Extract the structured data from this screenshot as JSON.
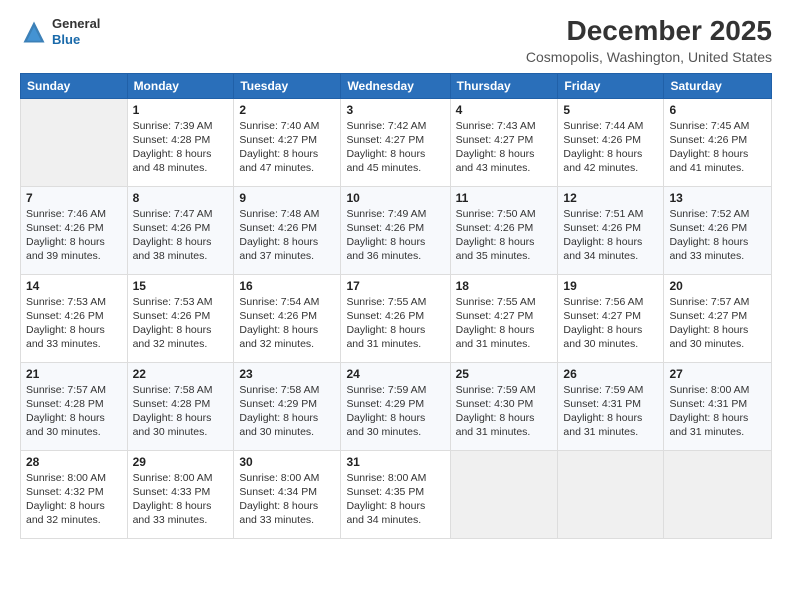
{
  "header": {
    "logo_general": "General",
    "logo_blue": "Blue",
    "month_title": "December 2025",
    "location": "Cosmopolis, Washington, United States"
  },
  "days_of_week": [
    "Sunday",
    "Monday",
    "Tuesday",
    "Wednesday",
    "Thursday",
    "Friday",
    "Saturday"
  ],
  "weeks": [
    [
      {
        "day": "",
        "info": ""
      },
      {
        "day": "1",
        "info": "Sunrise: 7:39 AM\nSunset: 4:28 PM\nDaylight: 8 hours\nand 48 minutes."
      },
      {
        "day": "2",
        "info": "Sunrise: 7:40 AM\nSunset: 4:27 PM\nDaylight: 8 hours\nand 47 minutes."
      },
      {
        "day": "3",
        "info": "Sunrise: 7:42 AM\nSunset: 4:27 PM\nDaylight: 8 hours\nand 45 minutes."
      },
      {
        "day": "4",
        "info": "Sunrise: 7:43 AM\nSunset: 4:27 PM\nDaylight: 8 hours\nand 43 minutes."
      },
      {
        "day": "5",
        "info": "Sunrise: 7:44 AM\nSunset: 4:26 PM\nDaylight: 8 hours\nand 42 minutes."
      },
      {
        "day": "6",
        "info": "Sunrise: 7:45 AM\nSunset: 4:26 PM\nDaylight: 8 hours\nand 41 minutes."
      }
    ],
    [
      {
        "day": "7",
        "info": "Sunrise: 7:46 AM\nSunset: 4:26 PM\nDaylight: 8 hours\nand 39 minutes."
      },
      {
        "day": "8",
        "info": "Sunrise: 7:47 AM\nSunset: 4:26 PM\nDaylight: 8 hours\nand 38 minutes."
      },
      {
        "day": "9",
        "info": "Sunrise: 7:48 AM\nSunset: 4:26 PM\nDaylight: 8 hours\nand 37 minutes."
      },
      {
        "day": "10",
        "info": "Sunrise: 7:49 AM\nSunset: 4:26 PM\nDaylight: 8 hours\nand 36 minutes."
      },
      {
        "day": "11",
        "info": "Sunrise: 7:50 AM\nSunset: 4:26 PM\nDaylight: 8 hours\nand 35 minutes."
      },
      {
        "day": "12",
        "info": "Sunrise: 7:51 AM\nSunset: 4:26 PM\nDaylight: 8 hours\nand 34 minutes."
      },
      {
        "day": "13",
        "info": "Sunrise: 7:52 AM\nSunset: 4:26 PM\nDaylight: 8 hours\nand 33 minutes."
      }
    ],
    [
      {
        "day": "14",
        "info": "Sunrise: 7:53 AM\nSunset: 4:26 PM\nDaylight: 8 hours\nand 33 minutes."
      },
      {
        "day": "15",
        "info": "Sunrise: 7:53 AM\nSunset: 4:26 PM\nDaylight: 8 hours\nand 32 minutes."
      },
      {
        "day": "16",
        "info": "Sunrise: 7:54 AM\nSunset: 4:26 PM\nDaylight: 8 hours\nand 32 minutes."
      },
      {
        "day": "17",
        "info": "Sunrise: 7:55 AM\nSunset: 4:26 PM\nDaylight: 8 hours\nand 31 minutes."
      },
      {
        "day": "18",
        "info": "Sunrise: 7:55 AM\nSunset: 4:27 PM\nDaylight: 8 hours\nand 31 minutes."
      },
      {
        "day": "19",
        "info": "Sunrise: 7:56 AM\nSunset: 4:27 PM\nDaylight: 8 hours\nand 30 minutes."
      },
      {
        "day": "20",
        "info": "Sunrise: 7:57 AM\nSunset: 4:27 PM\nDaylight: 8 hours\nand 30 minutes."
      }
    ],
    [
      {
        "day": "21",
        "info": "Sunrise: 7:57 AM\nSunset: 4:28 PM\nDaylight: 8 hours\nand 30 minutes."
      },
      {
        "day": "22",
        "info": "Sunrise: 7:58 AM\nSunset: 4:28 PM\nDaylight: 8 hours\nand 30 minutes."
      },
      {
        "day": "23",
        "info": "Sunrise: 7:58 AM\nSunset: 4:29 PM\nDaylight: 8 hours\nand 30 minutes."
      },
      {
        "day": "24",
        "info": "Sunrise: 7:59 AM\nSunset: 4:29 PM\nDaylight: 8 hours\nand 30 minutes."
      },
      {
        "day": "25",
        "info": "Sunrise: 7:59 AM\nSunset: 4:30 PM\nDaylight: 8 hours\nand 31 minutes."
      },
      {
        "day": "26",
        "info": "Sunrise: 7:59 AM\nSunset: 4:31 PM\nDaylight: 8 hours\nand 31 minutes."
      },
      {
        "day": "27",
        "info": "Sunrise: 8:00 AM\nSunset: 4:31 PM\nDaylight: 8 hours\nand 31 minutes."
      }
    ],
    [
      {
        "day": "28",
        "info": "Sunrise: 8:00 AM\nSunset: 4:32 PM\nDaylight: 8 hours\nand 32 minutes."
      },
      {
        "day": "29",
        "info": "Sunrise: 8:00 AM\nSunset: 4:33 PM\nDaylight: 8 hours\nand 33 minutes."
      },
      {
        "day": "30",
        "info": "Sunrise: 8:00 AM\nSunset: 4:34 PM\nDaylight: 8 hours\nand 33 minutes."
      },
      {
        "day": "31",
        "info": "Sunrise: 8:00 AM\nSunset: 4:35 PM\nDaylight: 8 hours\nand 34 minutes."
      },
      {
        "day": "",
        "info": ""
      },
      {
        "day": "",
        "info": ""
      },
      {
        "day": "",
        "info": ""
      }
    ]
  ]
}
